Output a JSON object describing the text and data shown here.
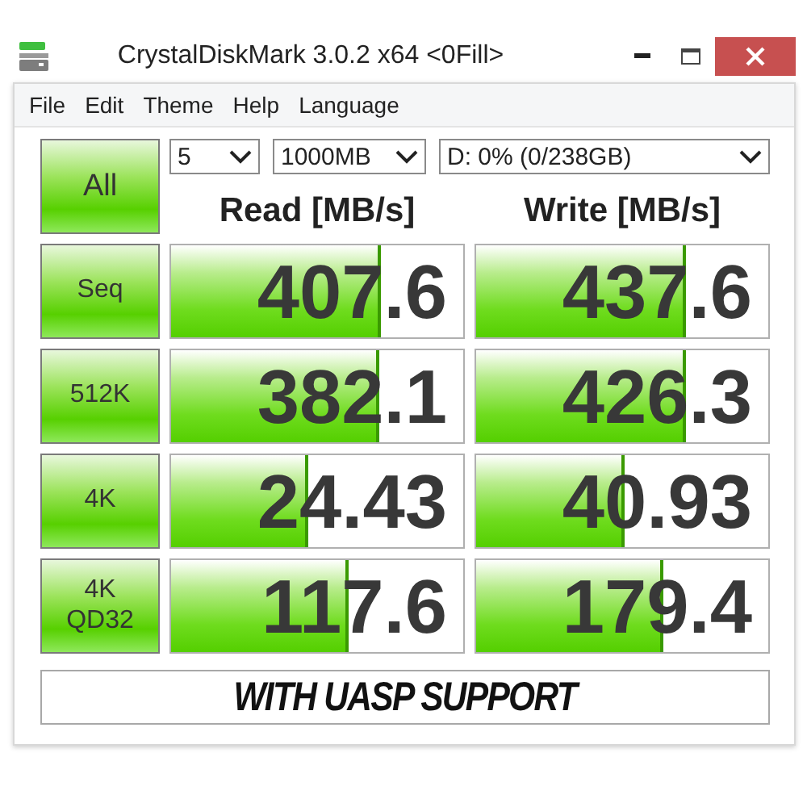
{
  "window": {
    "title": "CrystalDiskMark 3.0.2 x64 <0Fill>"
  },
  "menu": [
    "File",
    "Edit",
    "Theme",
    "Help",
    "Language"
  ],
  "controls": {
    "all_button": "All",
    "count": "5",
    "size": "1000MB",
    "drive": "D: 0% (0/238GB)"
  },
  "columns": [
    "Read [MB/s]",
    "Write [MB/s]"
  ],
  "rows": [
    {
      "test": "Seq",
      "read": {
        "value": "407.6",
        "level": 0.72
      },
      "write": {
        "value": "437.6",
        "level": 0.72
      }
    },
    {
      "test": "512K",
      "read": {
        "value": "382.1",
        "level": 0.71
      },
      "write": {
        "value": "426.3",
        "level": 0.72
      }
    },
    {
      "test": "4K",
      "read": {
        "value": "24.43",
        "level": 0.47
      },
      "write": {
        "value": "40.93",
        "level": 0.51
      }
    },
    {
      "test": "4K QD32",
      "read": {
        "value": "117.6",
        "level": 0.61
      },
      "write": {
        "value": "179.4",
        "level": 0.64
      }
    }
  ],
  "comment": "WITH UASP SUPPORT"
}
